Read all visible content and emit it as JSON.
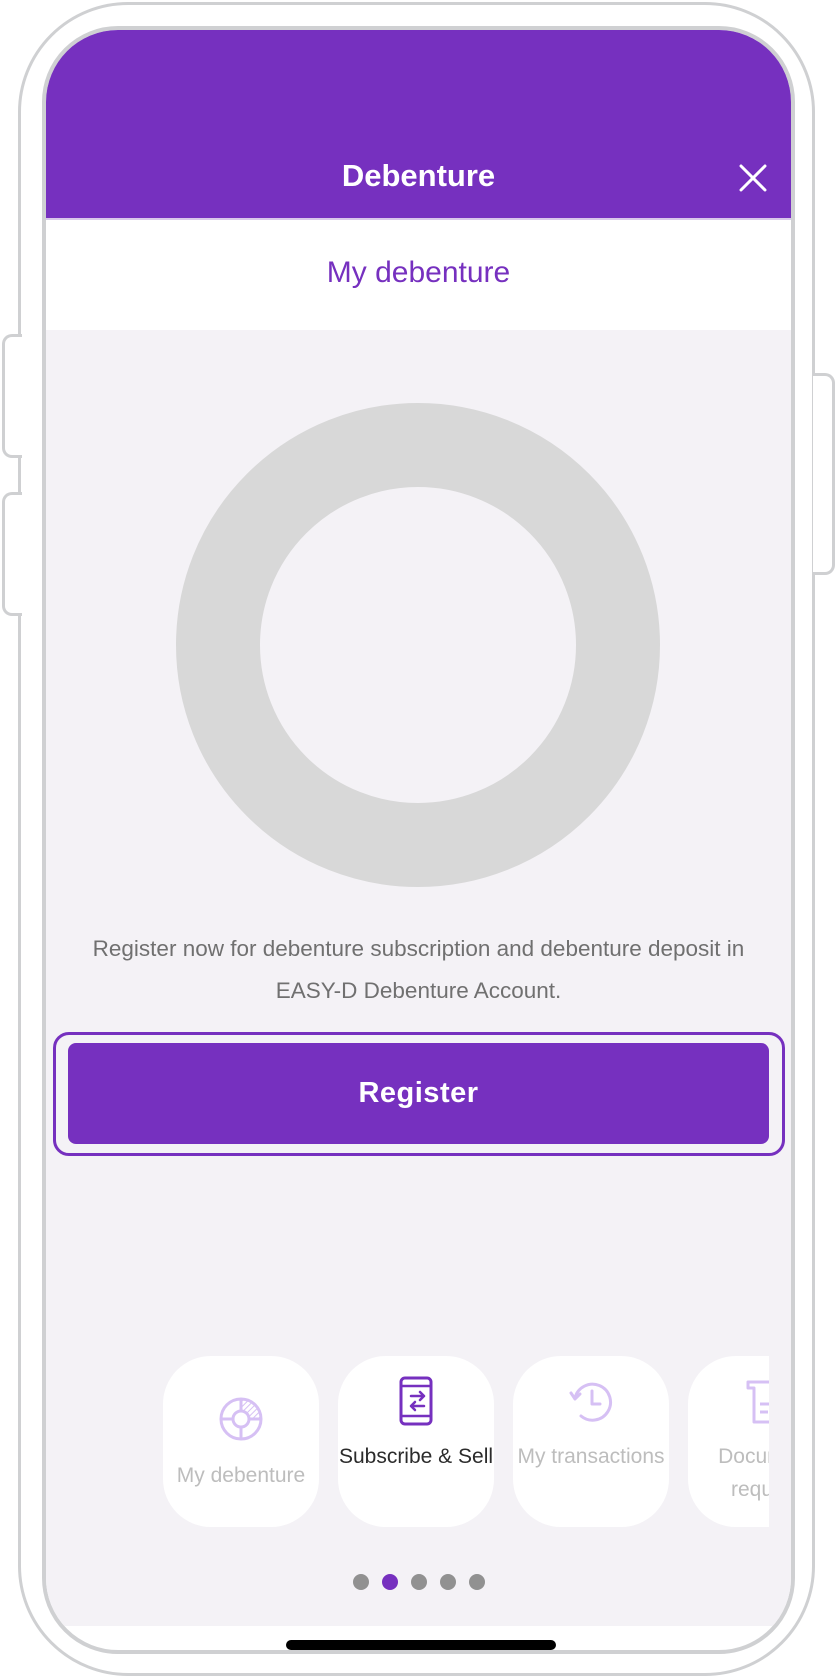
{
  "header": {
    "title": "Debenture",
    "close_icon": "close-icon"
  },
  "tab": {
    "label": "My debenture"
  },
  "placeholder_chart": {
    "type": "donut",
    "state": "empty",
    "color": "#d8d8d8"
  },
  "description": "Register now for debenture subscription and debenture deposit in EASY-D Debenture Account.",
  "register_button": {
    "label": "Register"
  },
  "carousel": {
    "items": [
      {
        "label": "My debenture",
        "icon": "pie-chart-icon",
        "active": false
      },
      {
        "label": "Subscribe & Sell",
        "icon": "phone-exchange-icon",
        "active": true
      },
      {
        "label": "My transactions",
        "icon": "history-clock-icon",
        "active": false
      },
      {
        "label": "Document request",
        "icon": "document-icon",
        "active": false,
        "clipped_label": "Docu req"
      }
    ],
    "page_count": 5,
    "active_page": 2
  },
  "colors": {
    "brand": "#7630bf",
    "icon_inactive": "#d6c0f4",
    "background": "#f4f2f6",
    "dot_inactive": "#919191"
  }
}
